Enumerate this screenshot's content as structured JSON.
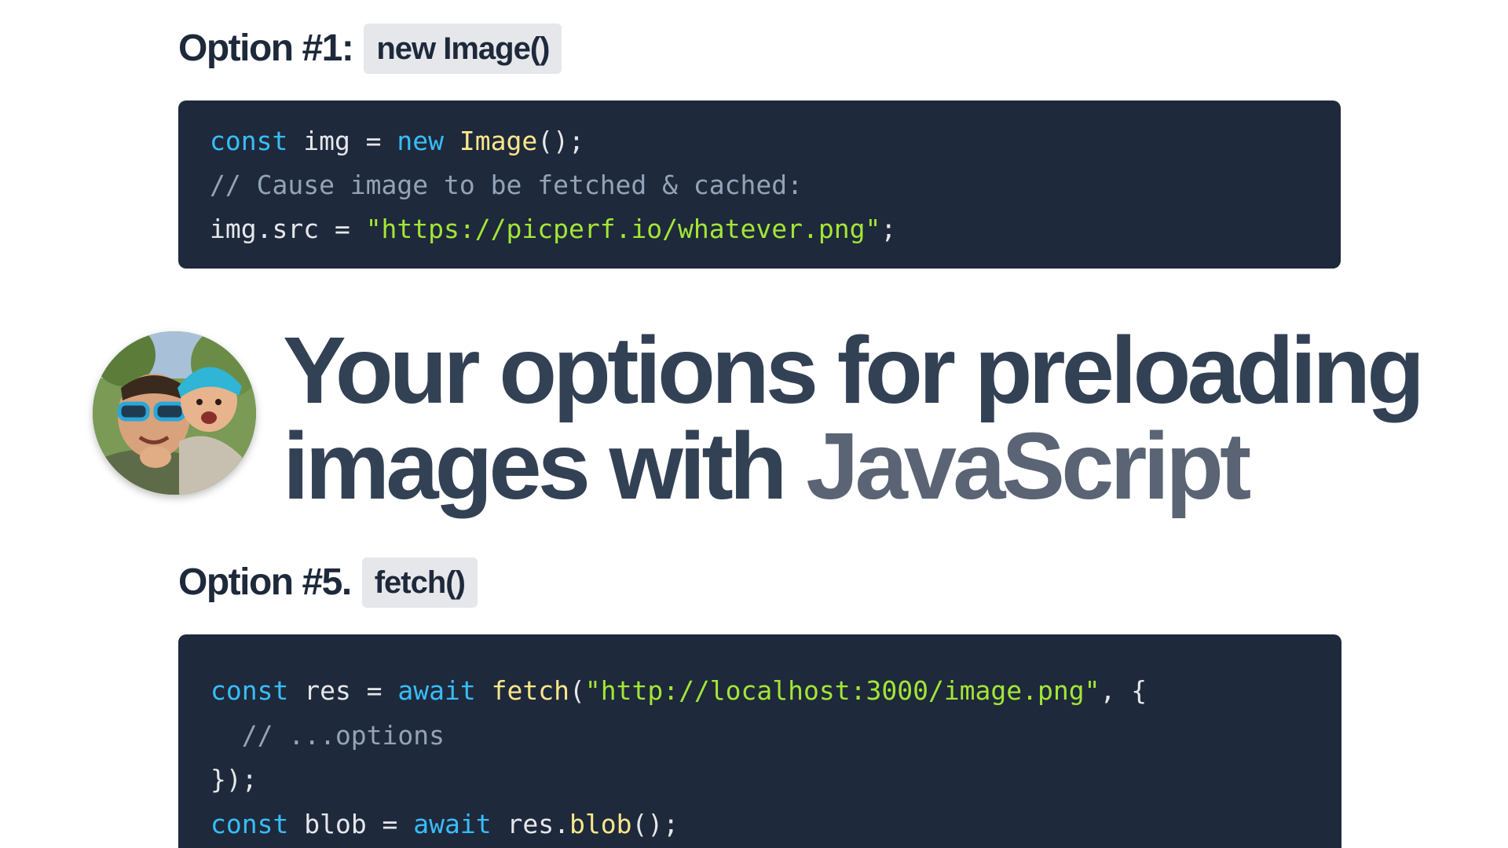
{
  "option1": {
    "label": "Option #1:",
    "method": "new Image()",
    "code": [
      [
        {
          "t": "const",
          "k": "keyword"
        },
        {
          "t": " img = ",
          "k": "plain"
        },
        {
          "t": "new",
          "k": "keyword"
        },
        {
          "t": " ",
          "k": "plain"
        },
        {
          "t": "Image",
          "k": "func"
        },
        {
          "t": "();",
          "k": "plain"
        }
      ],
      [
        {
          "t": "// Cause image to be fetched & cached:",
          "k": "comment"
        }
      ],
      [
        {
          "t": "img.src = ",
          "k": "plain"
        },
        {
          "t": "\"https://picperf.io/whatever.png\"",
          "k": "string"
        },
        {
          "t": ";",
          "k": "plain"
        }
      ]
    ]
  },
  "title": {
    "line1": "Your options for preloading",
    "line2_start": "images with ",
    "line2_end": "JavaScript"
  },
  "option5": {
    "label": "Option #5.",
    "method": "fetch()",
    "code": [
      [
        {
          "t": "const",
          "k": "keyword"
        },
        {
          "t": " res = ",
          "k": "plain"
        },
        {
          "t": "await",
          "k": "keyword"
        },
        {
          "t": " ",
          "k": "plain"
        },
        {
          "t": "fetch",
          "k": "func"
        },
        {
          "t": "(",
          "k": "plain"
        },
        {
          "t": "\"http://localhost:3000/image.png\"",
          "k": "string"
        },
        {
          "t": ", {",
          "k": "plain"
        }
      ],
      [
        {
          "t": "  // ...options",
          "k": "comment"
        }
      ],
      [
        {
          "t": "});",
          "k": "plain"
        }
      ],
      [
        {
          "t": "const",
          "k": "keyword"
        },
        {
          "t": " blob = ",
          "k": "plain"
        },
        {
          "t": "await",
          "k": "keyword"
        },
        {
          "t": " res.",
          "k": "plain"
        },
        {
          "t": "blob",
          "k": "func"
        },
        {
          "t": "();",
          "k": "plain"
        }
      ]
    ]
  },
  "colors": {
    "code_bg": "#1e293b",
    "keyword": "#38bdf8",
    "function": "#fde68a",
    "string": "#a3e635",
    "comment": "#94a3b8",
    "heading": "#1e293b",
    "pill_bg": "#e5e7eb"
  },
  "avatar": {
    "icon": "avatar-photo"
  }
}
